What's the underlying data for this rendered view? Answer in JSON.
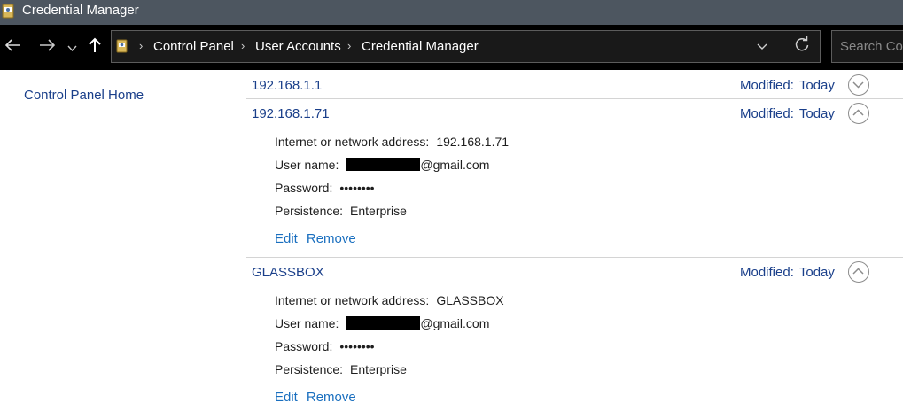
{
  "window": {
    "title": "Credential Manager",
    "icon": "credential-manager-icon"
  },
  "nav": {
    "back_icon": "arrow-left-icon",
    "forward_icon": "arrow-right-icon",
    "recent_icon": "chevron-down-icon",
    "up_icon": "arrow-up-icon"
  },
  "address": {
    "breadcrumbs": [
      "Control Panel",
      "User Accounts",
      "Credential Manager"
    ],
    "refresh_icon": "refresh-icon",
    "dropdown_icon": "chevron-down-icon"
  },
  "search": {
    "placeholder": "Search Cor"
  },
  "sidebar": {
    "home_link": "Control Panel Home"
  },
  "labels": {
    "modified": "Modified:",
    "address": "Internet or network address:",
    "username": "User name:",
    "password": "Password:",
    "persistence": "Persistence:",
    "edit": "Edit",
    "remove": "Remove"
  },
  "credentials": [
    {
      "name": "192.168.1.1",
      "modified": "Today",
      "expanded": false
    },
    {
      "name": "192.168.1.71",
      "modified": "Today",
      "expanded": true,
      "address": "192.168.1.71",
      "username_suffix": "@gmail.com",
      "password": "••••••••",
      "persistence": "Enterprise"
    },
    {
      "name": "GLASSBOX",
      "modified": "Today",
      "expanded": true,
      "address": "GLASSBOX",
      "username_suffix": "@gmail.com",
      "password": "••••••••",
      "persistence": "Enterprise"
    }
  ],
  "colors": {
    "link": "#1a3f8a",
    "action_link": "#1a6fbf",
    "titlebar": "#4d5660",
    "navbar": "#000000"
  }
}
